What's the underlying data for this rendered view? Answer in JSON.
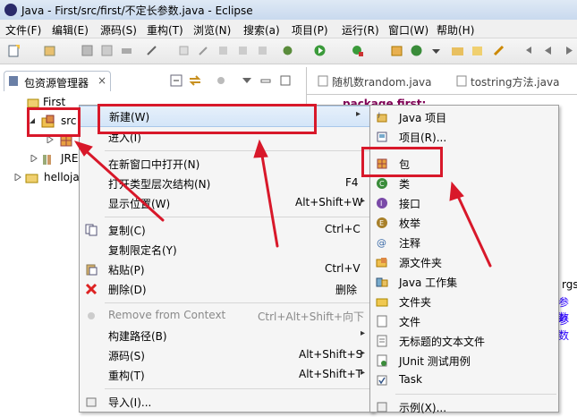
{
  "window": {
    "title": "Java - First/src/first/不定长参数.java - Eclipse"
  },
  "menubar": [
    "文件(F)",
    "编辑(E)",
    "源码(S)",
    "重构(T)",
    "浏览(N)",
    "搜索(a)",
    "项目(P)",
    "运行(R)",
    "窗口(W)",
    "帮助(H)"
  ],
  "package_explorer": {
    "tab_label": "包资源管理器",
    "close": "×",
    "tree": [
      "First",
      "src",
      "JRE",
      "helloja"
    ]
  },
  "editor": {
    "tabs": [
      "随机数random.java",
      "tostring方法.java"
    ],
    "code_fragments": [
      "package first;",
      "rgs",
      "参数",
      "参数"
    ]
  },
  "context_menu": [
    {
      "label": "新建(W)",
      "arrow": "▸"
    },
    {
      "label": "进入(I)"
    },
    {
      "label": "在新窗口中打开(N)"
    },
    {
      "label": "打开类型层次结构(N)",
      "shortcut": "F4"
    },
    {
      "label": "显示位置(W)",
      "shortcut": "Alt+Shift+W",
      "arrow": "▸"
    },
    {
      "label": "复制(C)",
      "shortcut": "Ctrl+C"
    },
    {
      "label": "复制限定名(Y)"
    },
    {
      "label": "粘贴(P)",
      "shortcut": "Ctrl+V"
    },
    {
      "label": "删除(D)",
      "shortcut": "删除"
    },
    {
      "label": "Remove from Context",
      "shortcut": "Ctrl+Alt+Shift+向下"
    },
    {
      "label": "构建路径(B)",
      "arrow": "▸"
    },
    {
      "label": "源码(S)",
      "shortcut": "Alt+Shift+S",
      "arrow": "▸"
    },
    {
      "label": "重构(T)",
      "shortcut": "Alt+Shift+T",
      "arrow": "▸"
    },
    {
      "label": "导入(I)..."
    }
  ],
  "submenu": [
    {
      "label": "Java 项目"
    },
    {
      "label": "项目(R)..."
    },
    {
      "label": "包"
    },
    {
      "label": "类"
    },
    {
      "label": "接口"
    },
    {
      "label": "枚举"
    },
    {
      "label": "注释"
    },
    {
      "label": "源文件夹"
    },
    {
      "label": "Java 工作集"
    },
    {
      "label": "文件夹"
    },
    {
      "label": "文件"
    },
    {
      "label": "无标题的文本文件"
    },
    {
      "label": "JUnit 测试用例"
    },
    {
      "label": "Task"
    },
    {
      "label": "示例(X)..."
    }
  ],
  "colors": {
    "annotation_red": "#d8182a"
  }
}
